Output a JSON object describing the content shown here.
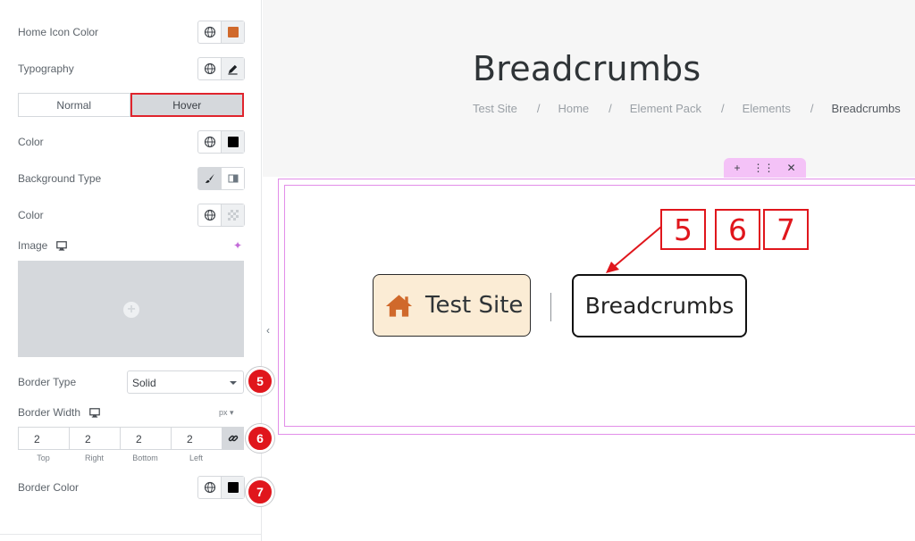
{
  "panel": {
    "home_icon_color": {
      "label": "Home Icon Color",
      "swatch": "#d0692b"
    },
    "typography": {
      "label": "Typography"
    },
    "tabs": [
      {
        "label": "Normal",
        "active": false
      },
      {
        "label": "Hover",
        "active": true
      }
    ],
    "color": {
      "label": "Color",
      "swatch": "#000000"
    },
    "background_type": {
      "label": "Background Type"
    },
    "bg_color": {
      "label": "Color"
    },
    "image": {
      "label": "Image"
    },
    "border_type": {
      "label": "Border Type",
      "value": "Solid"
    },
    "border_width": {
      "label": "Border Width",
      "unit": "px",
      "values": [
        "2",
        "2",
        "2",
        "2"
      ],
      "captions": [
        "Top",
        "Right",
        "Bottom",
        "Left"
      ]
    },
    "border_color": {
      "label": "Border Color",
      "swatch": "#000000"
    },
    "markers": [
      "5",
      "6",
      "7"
    ]
  },
  "preview": {
    "title": "Breadcrumbs",
    "breadcrumb_trail": [
      "Test Site",
      "Home",
      "Element Pack",
      "Elements",
      "Breadcrumbs"
    ],
    "separator": "/",
    "home_crumb": "Test Site",
    "current_crumb": "Breadcrumbs",
    "callouts": [
      "5",
      "6",
      "7"
    ]
  },
  "colors": {
    "accent_red": "#e0161c",
    "home_crumb_bg": "#fbecd5",
    "home_icon": "#d0692b",
    "editor_handle": "#f4c2f7"
  }
}
